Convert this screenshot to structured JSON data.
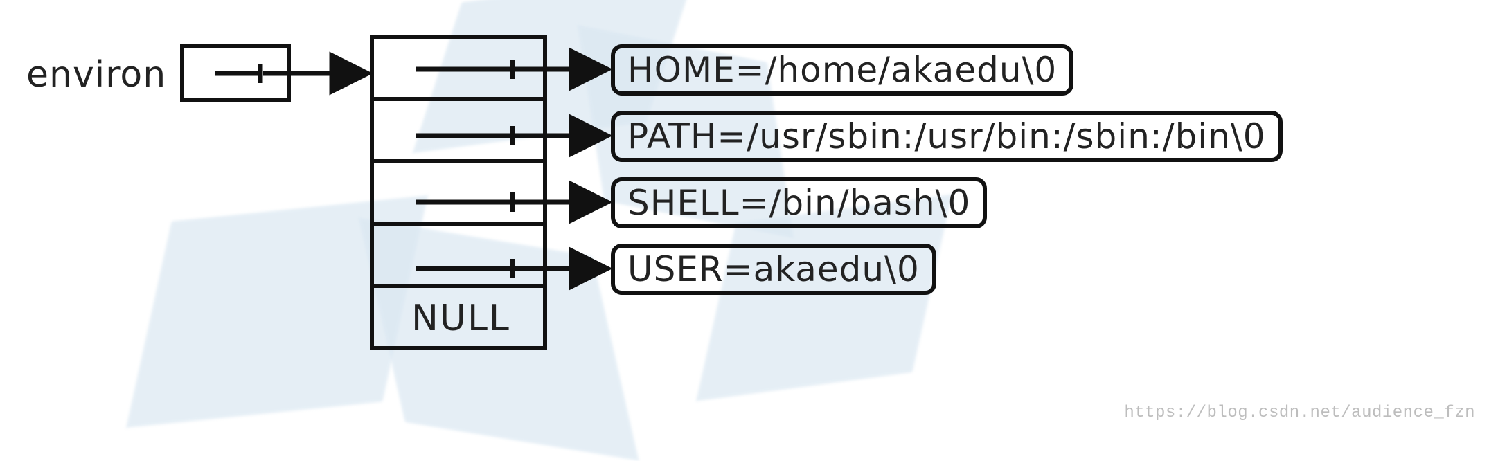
{
  "diagram": {
    "pointer_name": "environ",
    "array_terminator": "NULL",
    "strings": [
      "HOME=/home/akaedu\\0",
      "PATH=/usr/sbin:/usr/bin:/sbin:/bin\\0",
      "SHELL=/bin/bash\\0",
      "USER=akaedu\\0"
    ]
  },
  "watermark": "https://blog.csdn.net/audience_fzn"
}
